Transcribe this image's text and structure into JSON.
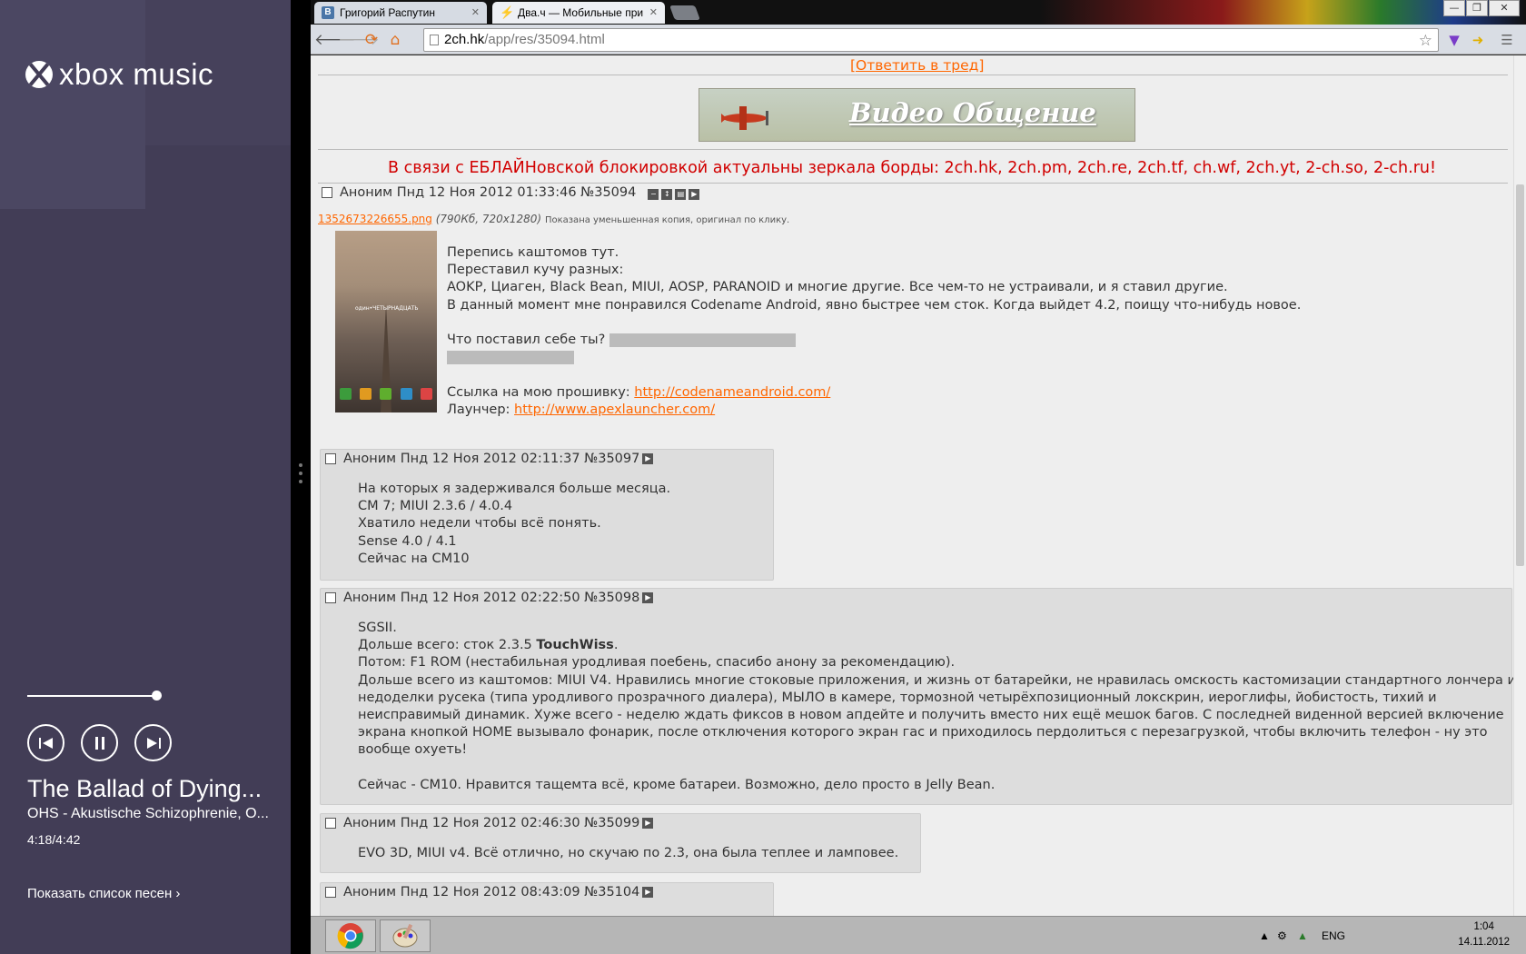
{
  "sidebar": {
    "app_title": "xbox music",
    "progress_fraction": 0.89,
    "song_title": "The Ballad of Dying...",
    "artist_album": "OHS - Akustische Schizophrenie, O...",
    "time": "4:18/4:42",
    "show_list": "Показать список песен ›"
  },
  "browser": {
    "tabs": [
      {
        "label": "Григорий Распутин",
        "favicon": "В",
        "color": "#4a76a8"
      },
      {
        "label": "Два.ч — Мобильные при",
        "favicon": "⚡",
        "color": "#e08020"
      }
    ],
    "url_host": "2ch.hk",
    "url_path": "/app/res/35094.html"
  },
  "page": {
    "reply_link": "[Ответить в тред]",
    "banner_text": "Видео Общение",
    "notice": "В связи с ЕБЛАЙНовской блокировкой актуальны зеркала борды: 2ch.hk, 2ch.pm, 2ch.re, 2ch.tf, ch.wf, 2ch.yt, 2-ch.so, 2-ch.ru!",
    "op": {
      "header": "Аноним  Пнд 12 Ноя 2012 01:33:46 №35094",
      "file_name": "1352673226655.png",
      "file_meta": "(790Кб, 720x1280)",
      "file_note": "Показана уменьшенная копия, оригинал по клику.",
      "thumb_caption": "один•ЧЕТЫРНАДЦАТЬ",
      "lines": [
        "Перепись каштомов тут.",
        "Переставил кучу разных:",
        "AOKP, Циаген, Black Bean, MIUI, AOSP, PARANOID и многие другие. Все чем-то не устраивали, и я ставил другие.",
        "В данный момент мне понравился Codename Android, явно быстрее чем сток. Когда выйдет 4.2, поищу что-нибудь новое.",
        "Что поставил себе ты?"
      ],
      "firmware_label": "Ссылка на мою прошивку: ",
      "firmware_url": "http://codenameandroid.com/",
      "launcher_label": "Лаунчер: ",
      "launcher_url": "http://www.apexlauncher.com/"
    },
    "replies": [
      {
        "header": "Аноним  Пнд 12 Ноя 2012 02:11:37 №35097",
        "lines": [
          "На которых я задерживался больше месяца.",
          "CM 7; MIUI 2.3.6 / 4.0.4",
          "Хватило недели чтобы всё понять.",
          "Sense 4.0 / 4.1",
          "Сейчас на CM10"
        ]
      },
      {
        "header": "Аноним  Пнд 12 Ноя 2012 02:22:50 №35098",
        "lines": [
          "SGSII.",
          "Дольше всего: сток 2.3.5 ",
          "Потом: F1 ROM (нестабильная уродливая поебень, спасибо анону за рекомендацию).",
          "Дольше всего из каштомов: MIUI V4. Нравились многие стоковые приложения, и жизнь от батарейки, не нравилась омскость кастомизации стандартного лончера и",
          "недоделки русека (типа уродливого прозрачного диалера), МЫЛО в камере, тормозной четырёхпозиционный локскрин, иероглифы, йобистость, тихий и",
          "неисправимый динамик. Хуже всего - неделю ждать фиксов в новом апдейте и получить вместо них ещё мешок багов. С последней виденной версией включение",
          "экрана кнопкой HOME вызывало фонарик, после отключения которого экран гас и приходилось пердолиться с перезагрузкой, чтобы включить телефон - ну это",
          "вообще охуеть!",
          "Сейчас - CM10. Нравится тащемта всё, кроме батареи. Возможно, дело просто в Jelly Bean."
        ],
        "bold_word": "TouchWiss"
      },
      {
        "header": "Аноним  Пнд 12 Ноя 2012 02:46:30 №35099",
        "lines": [
          "EVO 3D, MIUI v4. Всё отлично, но скучаю по 2.3, она была теплее и ламповее."
        ]
      },
      {
        "header": "Аноним  Пнд 12 Ноя 2012 08:43:09 №35104",
        "lines": []
      }
    ]
  },
  "taskbar": {
    "lang": "ENG",
    "time": "1:04",
    "date": "14.11.2012"
  }
}
